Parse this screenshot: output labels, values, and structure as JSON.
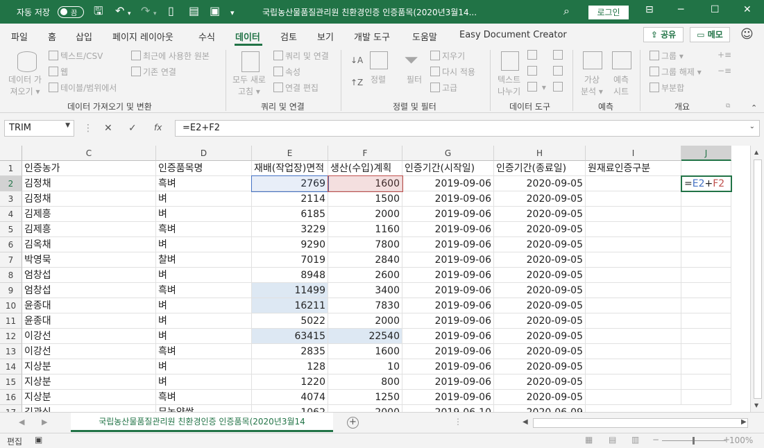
{
  "titlebar": {
    "autosave_label": "자동 저장",
    "autosave_state": "끔",
    "document_title": "국립농산물품질관리원 친환경인증 인증품목(2020년3월14...",
    "login_label": "로그인"
  },
  "tabs": [
    "파일",
    "홈",
    "삽입",
    "페이지 레이아웃",
    "수식",
    "데이터",
    "검토",
    "보기",
    "개발 도구",
    "도움말",
    "Easy Document Creator"
  ],
  "active_tab": "데이터",
  "share_label": "공유",
  "memo_label": "메모",
  "ribbon": {
    "get_data": {
      "big": [
        "데이터 가",
        "져오기"
      ],
      "items": [
        "텍스트/CSV",
        "웹",
        "테이블/범위에서",
        "최근에 사용한 원본",
        "기존 연결"
      ],
      "group": "데이터 가져오기 및 변환"
    },
    "queries": {
      "big": [
        "모두 새로",
        "고침"
      ],
      "items": [
        "쿼리 및 연결",
        "속성",
        "연결 편집"
      ],
      "group": "쿼리 및 연결"
    },
    "sort_filter": {
      "sort": "정렬",
      "filter": "필터",
      "items": [
        "지우기",
        "다시 적용",
        "고급"
      ],
      "group": "정렬 및 필터"
    },
    "tools": {
      "big": [
        "텍스트",
        "나누기"
      ],
      "group": "데이터 도구"
    },
    "forecast": {
      "what_if": [
        "가상",
        "분석"
      ],
      "sheet": [
        "예측",
        "시트"
      ],
      "group": "예측"
    },
    "outline": {
      "items": [
        "그룹",
        "그룹 해제",
        "부분합"
      ],
      "group": "개요"
    }
  },
  "formula_bar": {
    "name_box": "TRIM",
    "fx": "fx",
    "formula": "=E2+F2"
  },
  "columns": [
    "C",
    "D",
    "E",
    "F",
    "G",
    "H",
    "I",
    "J"
  ],
  "header_row": [
    "인증농가",
    "인증품목명",
    "재배(작업장)면적",
    "생산(수입)계획",
    "인증기간(시작일)",
    "인증기간(종료일)",
    "원재료인증구분",
    ""
  ],
  "rows": [
    {
      "n": "2",
      "c": "김정채",
      "d": "흑벼",
      "e": "2769",
      "f": "1600",
      "g": "2019-09-06",
      "h": "2020-09-05"
    },
    {
      "n": "3",
      "c": "김정채",
      "d": "벼",
      "e": "2114",
      "f": "1500",
      "g": "2019-09-06",
      "h": "2020-09-05"
    },
    {
      "n": "4",
      "c": "김제흥",
      "d": "벼",
      "e": "6185",
      "f": "2000",
      "g": "2019-09-06",
      "h": "2020-09-05"
    },
    {
      "n": "5",
      "c": "김제흥",
      "d": "흑벼",
      "e": "3229",
      "f": "1160",
      "g": "2019-09-06",
      "h": "2020-09-05"
    },
    {
      "n": "6",
      "c": "김옥채",
      "d": "벼",
      "e": "9290",
      "f": "7800",
      "g": "2019-09-06",
      "h": "2020-09-05"
    },
    {
      "n": "7",
      "c": "박영묵",
      "d": "찰벼",
      "e": "7019",
      "f": "2840",
      "g": "2019-09-06",
      "h": "2020-09-05"
    },
    {
      "n": "8",
      "c": "엄창섭",
      "d": "벼",
      "e": "8948",
      "f": "2600",
      "g": "2019-09-06",
      "h": "2020-09-05"
    },
    {
      "n": "9",
      "c": "엄창섭",
      "d": "흑벼",
      "e": "11499",
      "f": "3400",
      "g": "2019-09-06",
      "h": "2020-09-05"
    },
    {
      "n": "10",
      "c": "윤종대",
      "d": "벼",
      "e": "16211",
      "f": "7830",
      "g": "2019-09-06",
      "h": "2020-09-05"
    },
    {
      "n": "11",
      "c": "윤종대",
      "d": "벼",
      "e": "5022",
      "f": "2000",
      "g": "2019-09-06",
      "h": "2020-09-05"
    },
    {
      "n": "12",
      "c": "이강선",
      "d": "벼",
      "e": "63415",
      "f": "22540",
      "g": "2019-09-06",
      "h": "2020-09-05"
    },
    {
      "n": "13",
      "c": "이강선",
      "d": "흑벼",
      "e": "2835",
      "f": "1600",
      "g": "2019-09-06",
      "h": "2020-09-05"
    },
    {
      "n": "14",
      "c": "지상분",
      "d": "벼",
      "e": "128",
      "f": "10",
      "g": "2019-09-06",
      "h": "2020-09-05"
    },
    {
      "n": "15",
      "c": "지상분",
      "d": "벼",
      "e": "1220",
      "f": "800",
      "g": "2019-09-06",
      "h": "2020-09-05"
    },
    {
      "n": "16",
      "c": "지상분",
      "d": "흑벼",
      "e": "4074",
      "f": "1250",
      "g": "2019-09-06",
      "h": "2020-09-05"
    }
  ],
  "editing_cell": {
    "prefix": "=",
    "ref1": "E2",
    "op": "+",
    "ref2": "F2"
  },
  "sheet_tab": "국립농산물품질관리원 친환경인증 인증품목(2020년3월14",
  "status": {
    "mode": "편집",
    "zoom": "100%"
  },
  "colors": {
    "accent": "#217346",
    "ref_blue": "#4472c4",
    "ref_red": "#c0504d"
  }
}
